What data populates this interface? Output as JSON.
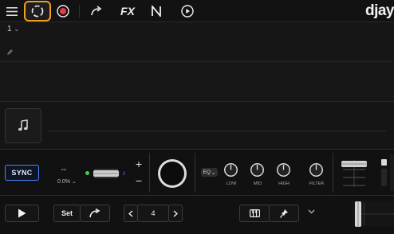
{
  "app": {
    "logo": "djay"
  },
  "toolbar": {
    "items": [
      {
        "name": "menu-icon"
      },
      {
        "name": "automix-icon",
        "highlighted": true
      },
      {
        "name": "record-icon",
        "color": "#e8394a"
      },
      {
        "name": "redo-icon"
      },
      {
        "name": "fx-icon",
        "label": "FX"
      },
      {
        "name": "neural-mix-icon"
      },
      {
        "name": "play-circle-icon"
      }
    ],
    "fx_label": "FX"
  },
  "deck": {
    "number": "1",
    "number_chevron": "⌄"
  },
  "mixer": {
    "sync_label": "SYNC",
    "bpm": "--",
    "pitch": "0.0%",
    "pitch_chevron": "⌄",
    "eq_label": "EQ",
    "eq_chevron": "⌄",
    "knobs": [
      {
        "label": "LOW"
      },
      {
        "label": "MID"
      },
      {
        "label": "HIGH"
      },
      {
        "label": "FILTER"
      }
    ],
    "plus": "+",
    "minus": "−"
  },
  "transport": {
    "set_label": "Set",
    "loop_value": "4"
  },
  "colors": {
    "accent_highlight": "#f0a020",
    "sync_border": "#4a86ff",
    "record": "#e8394a",
    "sync_indicator": "#3ccf4e"
  }
}
